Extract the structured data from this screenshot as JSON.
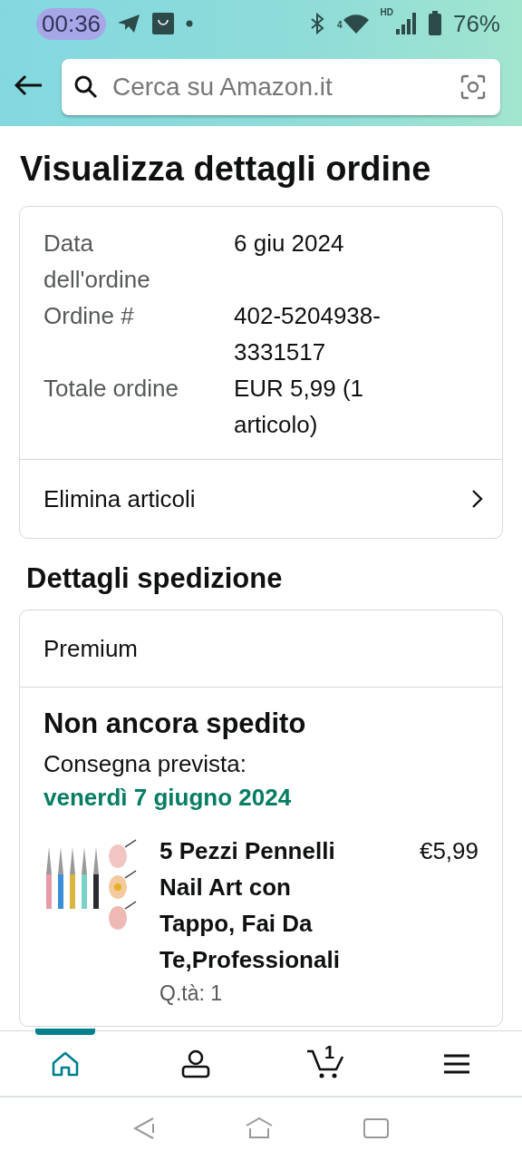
{
  "status_bar": {
    "time": "00:36",
    "network_label": "HD",
    "wifi_label": "4",
    "battery": "76%"
  },
  "search": {
    "placeholder": "Cerca su Amazon.it"
  },
  "title": "Visualizza dettagli ordine",
  "order_summary": [
    {
      "label": "Data dell'ordine",
      "value": "6 giu 2024"
    },
    {
      "label": "Ordine #",
      "value": "402-5204938-3331517"
    },
    {
      "label": "Totale ordine",
      "value": "EUR 5,99 (1 articolo)"
    }
  ],
  "order_action": "Elimina articoli",
  "shipping": {
    "heading": "Dettagli spedizione",
    "service": "Premium",
    "status": "Non ancora spedito",
    "delivery_label": "Consegna prevista:",
    "delivery_date": "venerdì 7 giugno 2024",
    "items": [
      {
        "name": "5 Pezzi Pennelli Nail Art con Tappo, Fai Da Te,Professionali",
        "price": "€5,99",
        "quantity": "Q.tà: 1"
      }
    ]
  },
  "bottom_nav": [
    {
      "kind": "home",
      "selected": true
    },
    {
      "kind": "account",
      "selected": false
    },
    {
      "kind": "cart",
      "selected": false,
      "count": "1"
    },
    {
      "kind": "menu",
      "selected": false
    }
  ]
}
